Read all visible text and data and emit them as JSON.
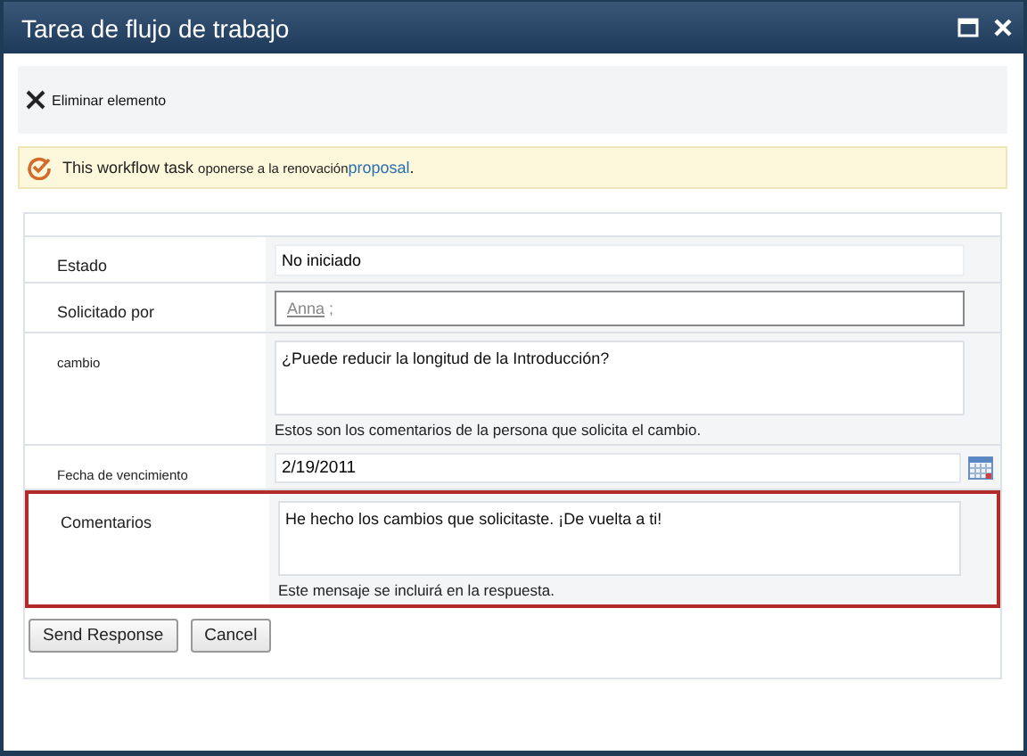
{
  "window": {
    "title": "Tarea de flujo de trabajo"
  },
  "toolbar": {
    "actions": [
      {
        "label": "Eliminar elemento"
      }
    ]
  },
  "notice": {
    "text": "This workflow task",
    "small_text": "oponerse a la renovación",
    "link": "proposal",
    "end": "."
  },
  "fields": [
    {
      "label": "Estado",
      "kind": "readonly",
      "value": "No iniciado",
      "highlighted": false
    },
    {
      "label": "Solicitado por",
      "kind": "people",
      "value": "Anna",
      "separator": ";",
      "highlighted": false
    },
    {
      "label": "cambio",
      "kind": "textarea",
      "small_label": true,
      "value": "¿Puede reducir la longitud de la Introducción?",
      "hint": "Estos son los comentarios de la persona que solicita el cambio.",
      "highlighted": false
    },
    {
      "label": "Fecha de vencimiento",
      "kind": "date",
      "small_label": true,
      "value": "2/19/2011",
      "highlighted": false
    },
    {
      "label": "Comentarios",
      "kind": "textarea",
      "value": "He hecho los cambios que solicitaste. ¡De vuelta a ti!",
      "hint": "Este mensaje se incluirá en la respuesta.",
      "highlighted": true
    }
  ],
  "buttons": [
    {
      "label": "Send Response"
    },
    {
      "label": "Cancel"
    }
  ]
}
